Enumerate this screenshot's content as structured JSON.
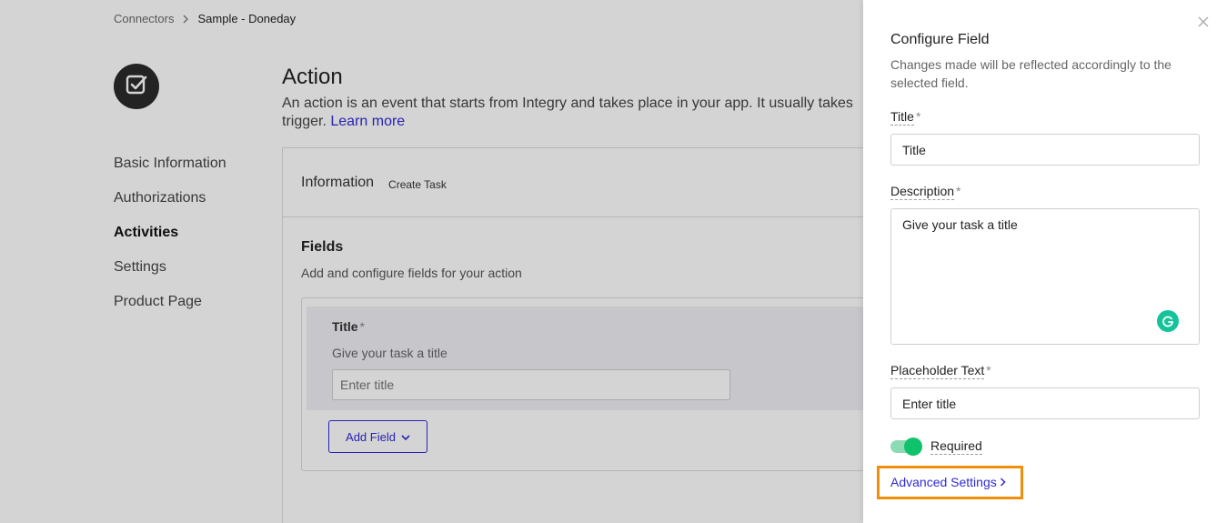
{
  "breadcrumb": {
    "parent": "Connectors",
    "current": "Sample - Doneday"
  },
  "side_nav": {
    "items": [
      {
        "label": "Basic Information"
      },
      {
        "label": "Authorizations"
      },
      {
        "label": "Activities"
      },
      {
        "label": "Settings"
      },
      {
        "label": "Product Page"
      }
    ],
    "active": "Activities"
  },
  "action": {
    "title": "Action",
    "description_line1": "An action is an event that starts from Integry and takes place in your app. It usually takes",
    "description_line2": "trigger.",
    "learn_more": "Learn more"
  },
  "card": {
    "info_label": "Information",
    "info_value": "Create Task",
    "fields_title": "Fields",
    "fields_sub": "Add and configure fields for your action",
    "field": {
      "title": "Title",
      "required_mark": "*",
      "description": "Give your task a title",
      "placeholder": "Enter title"
    },
    "add_field_label": "Add Field"
  },
  "drawer": {
    "title": "Configure Field",
    "subtitle": "Changes made will be reflected accordingly to the selected field.",
    "title_label": "Title",
    "title_value": "Title",
    "description_label": "Description",
    "description_value": "Give your task a title",
    "placeholder_label": "Placeholder Text",
    "placeholder_value": "Enter title",
    "required_mark": "*",
    "required_label": "Required",
    "required_on": true,
    "advanced_settings": "Advanced Settings"
  },
  "colors": {
    "accent": "#2f2bd6",
    "toggle_on": "#11c26d",
    "highlight": "#f0900a",
    "grammarly": "#15c39a"
  }
}
